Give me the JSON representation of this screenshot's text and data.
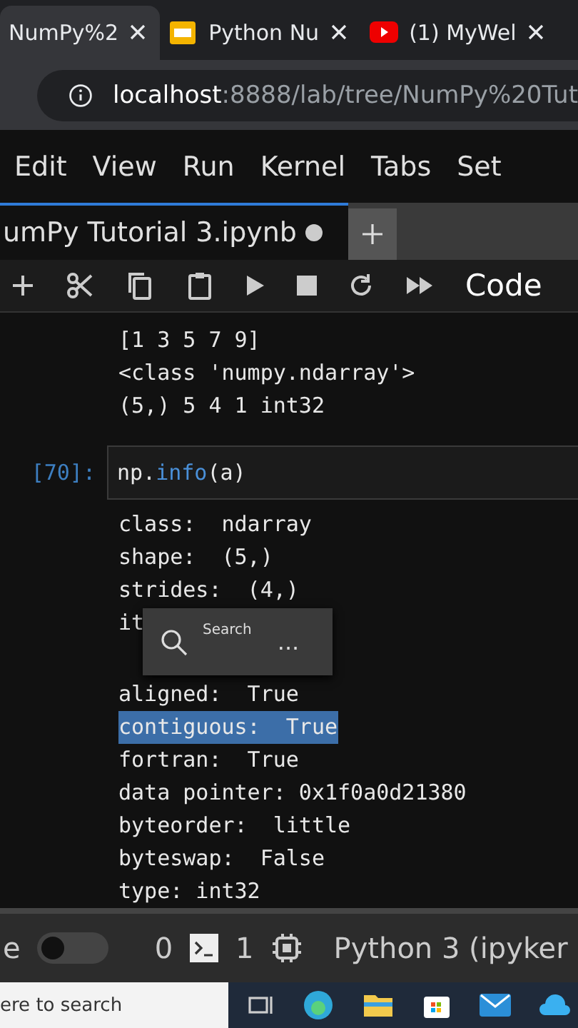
{
  "browser_tabs": [
    {
      "title": "NumPy%2",
      "selected": true,
      "kind": "plain"
    },
    {
      "title": "Python Nu",
      "selected": false,
      "kind": "slides"
    },
    {
      "title": "(1) MyWel",
      "selected": false,
      "kind": "video"
    }
  ],
  "address": {
    "host": "localhost",
    "path": ":8888/lab/tree/NumPy%20Tut"
  },
  "menu": [
    "Edit",
    "View",
    "Run",
    "Kernel",
    "Tabs",
    "Set"
  ],
  "notebook_tab": {
    "title": "umPy Tutorial 3.ipynb",
    "modified": true
  },
  "toolbar": {
    "cell_type": "Code"
  },
  "outputs_top": [
    "[1 3 5 7 9]",
    "<class 'numpy.ndarray'>",
    "(5,) 5 4 1 int32"
  ],
  "cell": {
    "prompt": "[70]:",
    "code": [
      {
        "text": "np.",
        "kind": "plain"
      },
      {
        "text": "info",
        "kind": "func"
      },
      {
        "text": "(a)",
        "kind": "plain"
      }
    ]
  },
  "info_lines": [
    {
      "text": "class:  ndarray",
      "selected": false,
      "kind": "line"
    },
    {
      "text": "shape:  (5,)",
      "selected": false,
      "kind": "line"
    },
    {
      "text": "strides:  (4,)",
      "selected": false,
      "kind": "line"
    },
    {
      "text": "it",
      "selected": false,
      "kind": "covered"
    },
    {
      "text": "aligned:  True",
      "selected": false,
      "kind": "line"
    },
    {
      "text": "contiguous:  True",
      "selected": true,
      "kind": "line"
    },
    {
      "text": "fortran:  True",
      "selected": false,
      "kind": "line"
    },
    {
      "text": "data pointer: 0x1f0a0d21380",
      "selected": false,
      "kind": "line"
    },
    {
      "text": "byteorder:  little",
      "selected": false,
      "kind": "line"
    },
    {
      "text": "byteswap:  False",
      "selected": false,
      "kind": "line"
    },
    {
      "text": "type: int32",
      "selected": false,
      "kind": "line"
    }
  ],
  "popup": {
    "label": "Search",
    "more": "..."
  },
  "status_bar": {
    "mode": "e",
    "toggle_on": false,
    "terminals": "0",
    "kernels": "1",
    "kernel_name": "Python 3 (ipyker"
  },
  "taskbar": {
    "search_placeholder": "ere to search"
  }
}
